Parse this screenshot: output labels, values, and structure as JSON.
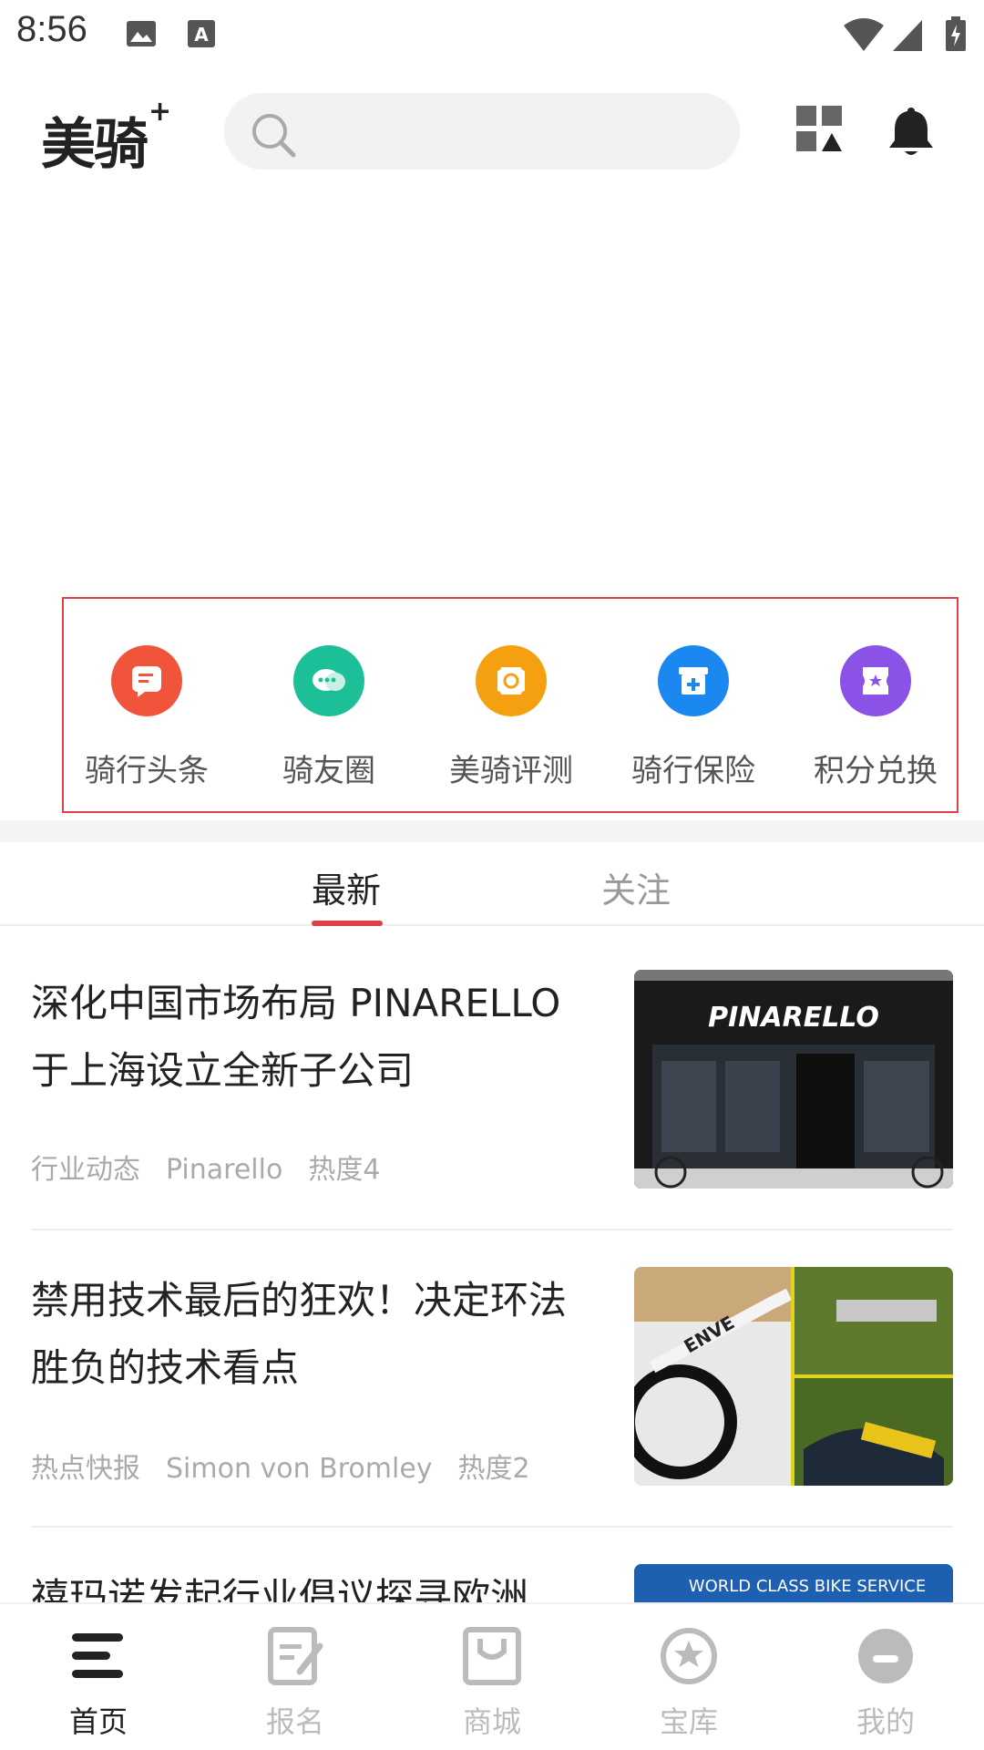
{
  "status_bar": {
    "time": "8:56"
  },
  "header": {
    "logo_text": "美骑",
    "logo_sup": "+",
    "search_placeholder": ""
  },
  "quick_nav": {
    "items": [
      {
        "label": "骑行头条",
        "icon": "news-icon",
        "color": "#f0553c"
      },
      {
        "label": "骑友圈",
        "icon": "chat-icon",
        "color": "#1dbf98"
      },
      {
        "label": "美骑评测",
        "icon": "review-icon",
        "color": "#f5a010"
      },
      {
        "label": "骑行保险",
        "icon": "insurance-icon",
        "color": "#1a88f0"
      },
      {
        "label": "积分兑换",
        "icon": "points-icon",
        "color": "#8b52e8"
      }
    ]
  },
  "tabs": [
    {
      "label": "最新",
      "active": true
    },
    {
      "label": "关注",
      "active": false
    }
  ],
  "articles": [
    {
      "title": "深化中国市场布局 PINARELLO 于上海设立全新子公司",
      "category": "行业动态",
      "author": "Pinarello",
      "heat": "热度4",
      "thumb_text": "PINARELLO"
    },
    {
      "title": "禁用技术最后的狂欢！决定环法胜负的技术看点",
      "category": "热点快报",
      "author": "Simon von Bromley",
      "heat": "热度2",
      "thumb_text": "ENVE"
    },
    {
      "title": "禧玛诺发起行业倡议探寻欧洲",
      "thumb_text": "WORLD CLASS BIKE SERVICE"
    }
  ],
  "bottom_nav": [
    {
      "label": "首页",
      "icon": "home-icon",
      "active": true
    },
    {
      "label": "报名",
      "icon": "signup-icon",
      "active": false
    },
    {
      "label": "商城",
      "icon": "shop-icon",
      "active": false
    },
    {
      "label": "宝库",
      "icon": "treasure-icon",
      "active": false
    },
    {
      "label": "我的",
      "icon": "profile-icon",
      "active": false
    }
  ],
  "colors": {
    "accent": "#e0404a",
    "muted_text": "#aaaaaa"
  }
}
